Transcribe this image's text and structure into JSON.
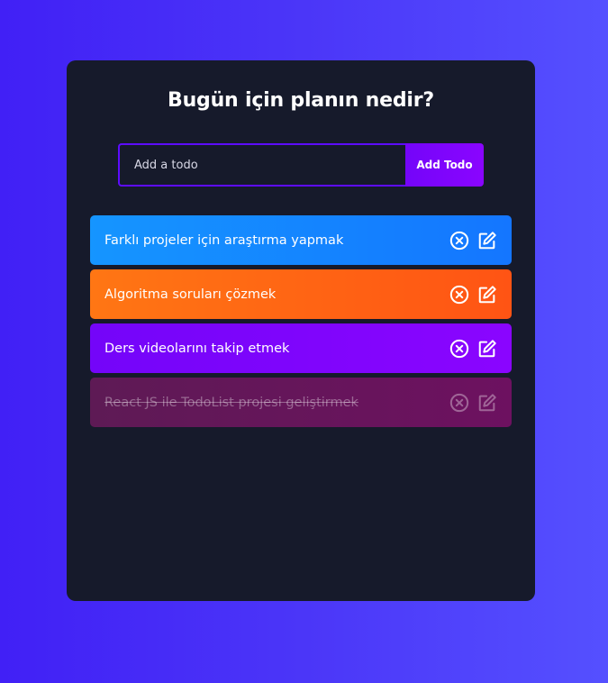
{
  "app": {
    "title": "Bugün için planın nedir?"
  },
  "form": {
    "placeholder": "Add a todo",
    "value": "",
    "button_label": "Add Todo"
  },
  "todos": [
    {
      "text": "Farklı projeler için araştırma yapmak",
      "completed": false,
      "color": "#1595ff"
    },
    {
      "text": "Algoritma soruları çözmek",
      "completed": false,
      "color": "#ff7614"
    },
    {
      "text": "Ders videolarını takip etmek",
      "completed": false,
      "color": "#7405f9"
    },
    {
      "text": "React JS ile TodoList projesi geliştirmek",
      "completed": true,
      "color": "#5e1a55"
    }
  ],
  "icons": {
    "remove": "close-circle-icon",
    "edit": "edit-icon"
  }
}
